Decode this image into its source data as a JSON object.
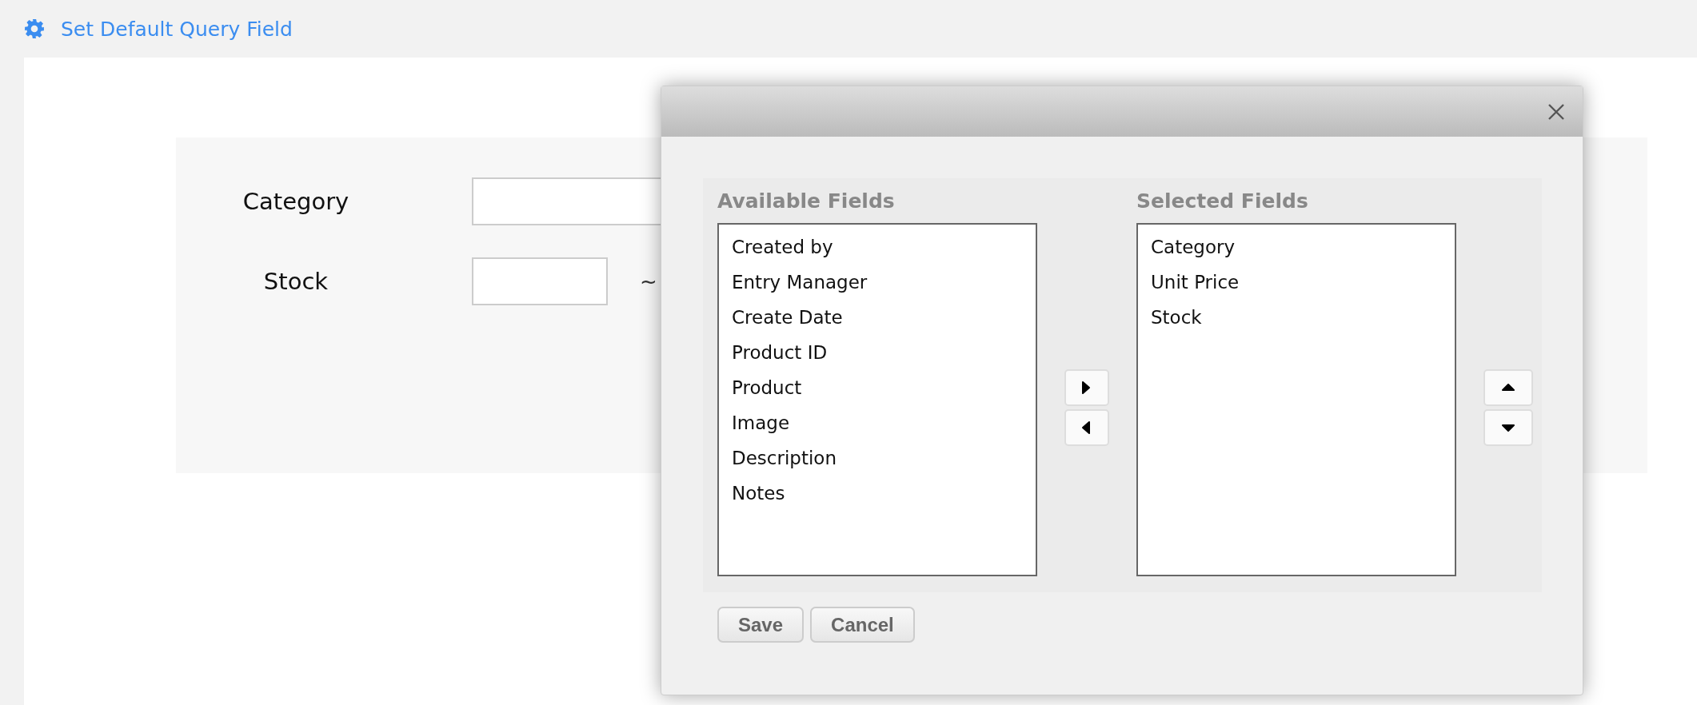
{
  "header": {
    "title": "Set Default Query Field"
  },
  "query_form": {
    "fields": [
      {
        "label": "Category",
        "kind": "text"
      },
      {
        "label": "Stock",
        "kind": "range",
        "separator": "~"
      }
    ]
  },
  "dialog": {
    "available": {
      "heading": "Available Fields",
      "items": [
        "Created by",
        "Entry Manager",
        "Create Date",
        "Product ID",
        "Product",
        "Image",
        "Description",
        "Notes"
      ]
    },
    "selected": {
      "heading": "Selected Fields",
      "items": [
        "Category",
        "Unit Price",
        "Stock"
      ]
    },
    "buttons": [
      "Save",
      "Cancel"
    ]
  }
}
